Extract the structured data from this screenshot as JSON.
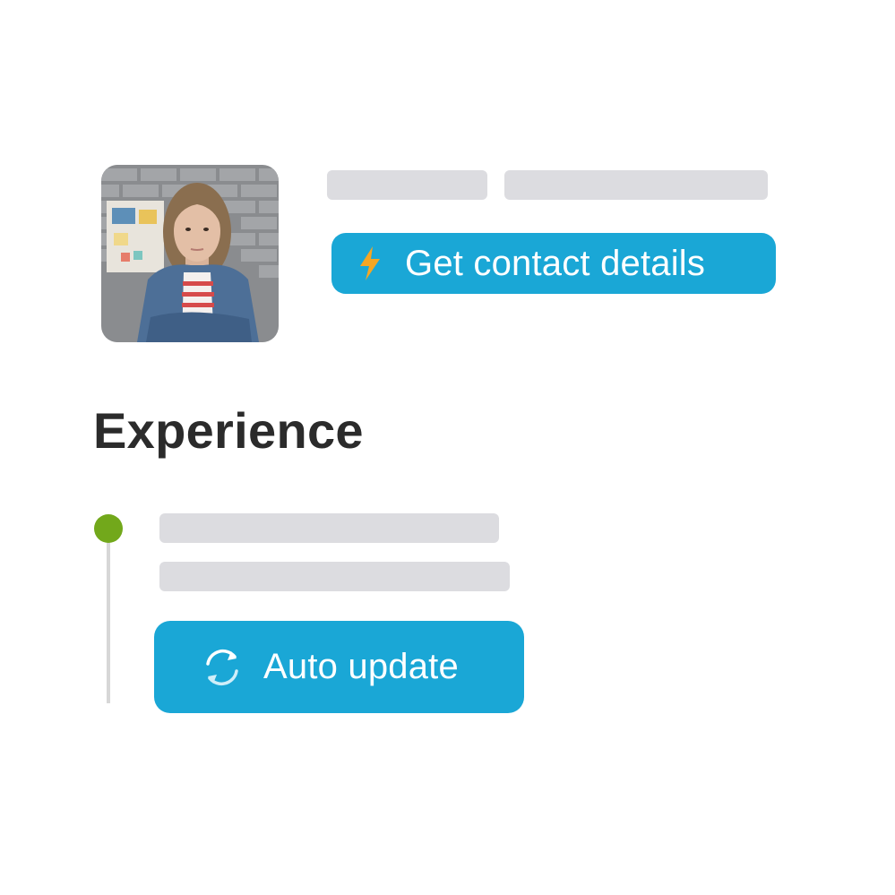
{
  "profile": {
    "avatar_icon": "person-photo"
  },
  "actions": {
    "contact_label": "Get contact details",
    "contact_icon": "lightning-icon",
    "auto_update_label": "Auto update",
    "auto_update_icon": "refresh-icon"
  },
  "experience": {
    "heading": "Experience"
  },
  "colors": {
    "accent": "#1aa7d6",
    "lightning": "#f5a623",
    "timeline_dot": "#72a81b",
    "skeleton": "#dcdce0",
    "heading": "#2b2b2b"
  }
}
